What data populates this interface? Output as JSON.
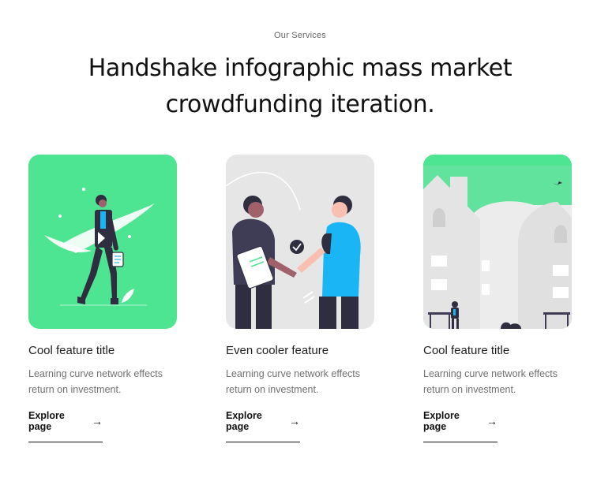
{
  "section": {
    "eyebrow": "Our Services",
    "headline_line1": "Handshake infographic mass market",
    "headline_line2": "crowdfunding iteration."
  },
  "cards": [
    {
      "title": "Cool feature title",
      "desc_line1": "Learning curve network effects",
      "desc_line2": "return on investment.",
      "link": "Explore page",
      "bg": "#4ee592"
    },
    {
      "title": "Even cooler feature",
      "desc_line1": "Learning curve network effects",
      "desc_line2": "return on investment.",
      "link": "Explore page",
      "bg": "#e6e6e6"
    },
    {
      "title": "Cool feature title",
      "desc_line1": "Learning curve network effects",
      "desc_line2": "return on investment.",
      "link": "Explore page",
      "bg": "#4ee592"
    }
  ],
  "icons": {
    "arrow": "arrow-right-icon"
  },
  "colors": {
    "accent_green": "#4ee592",
    "accent_blue": "#1ab5f5",
    "dark": "#2f2e41"
  }
}
